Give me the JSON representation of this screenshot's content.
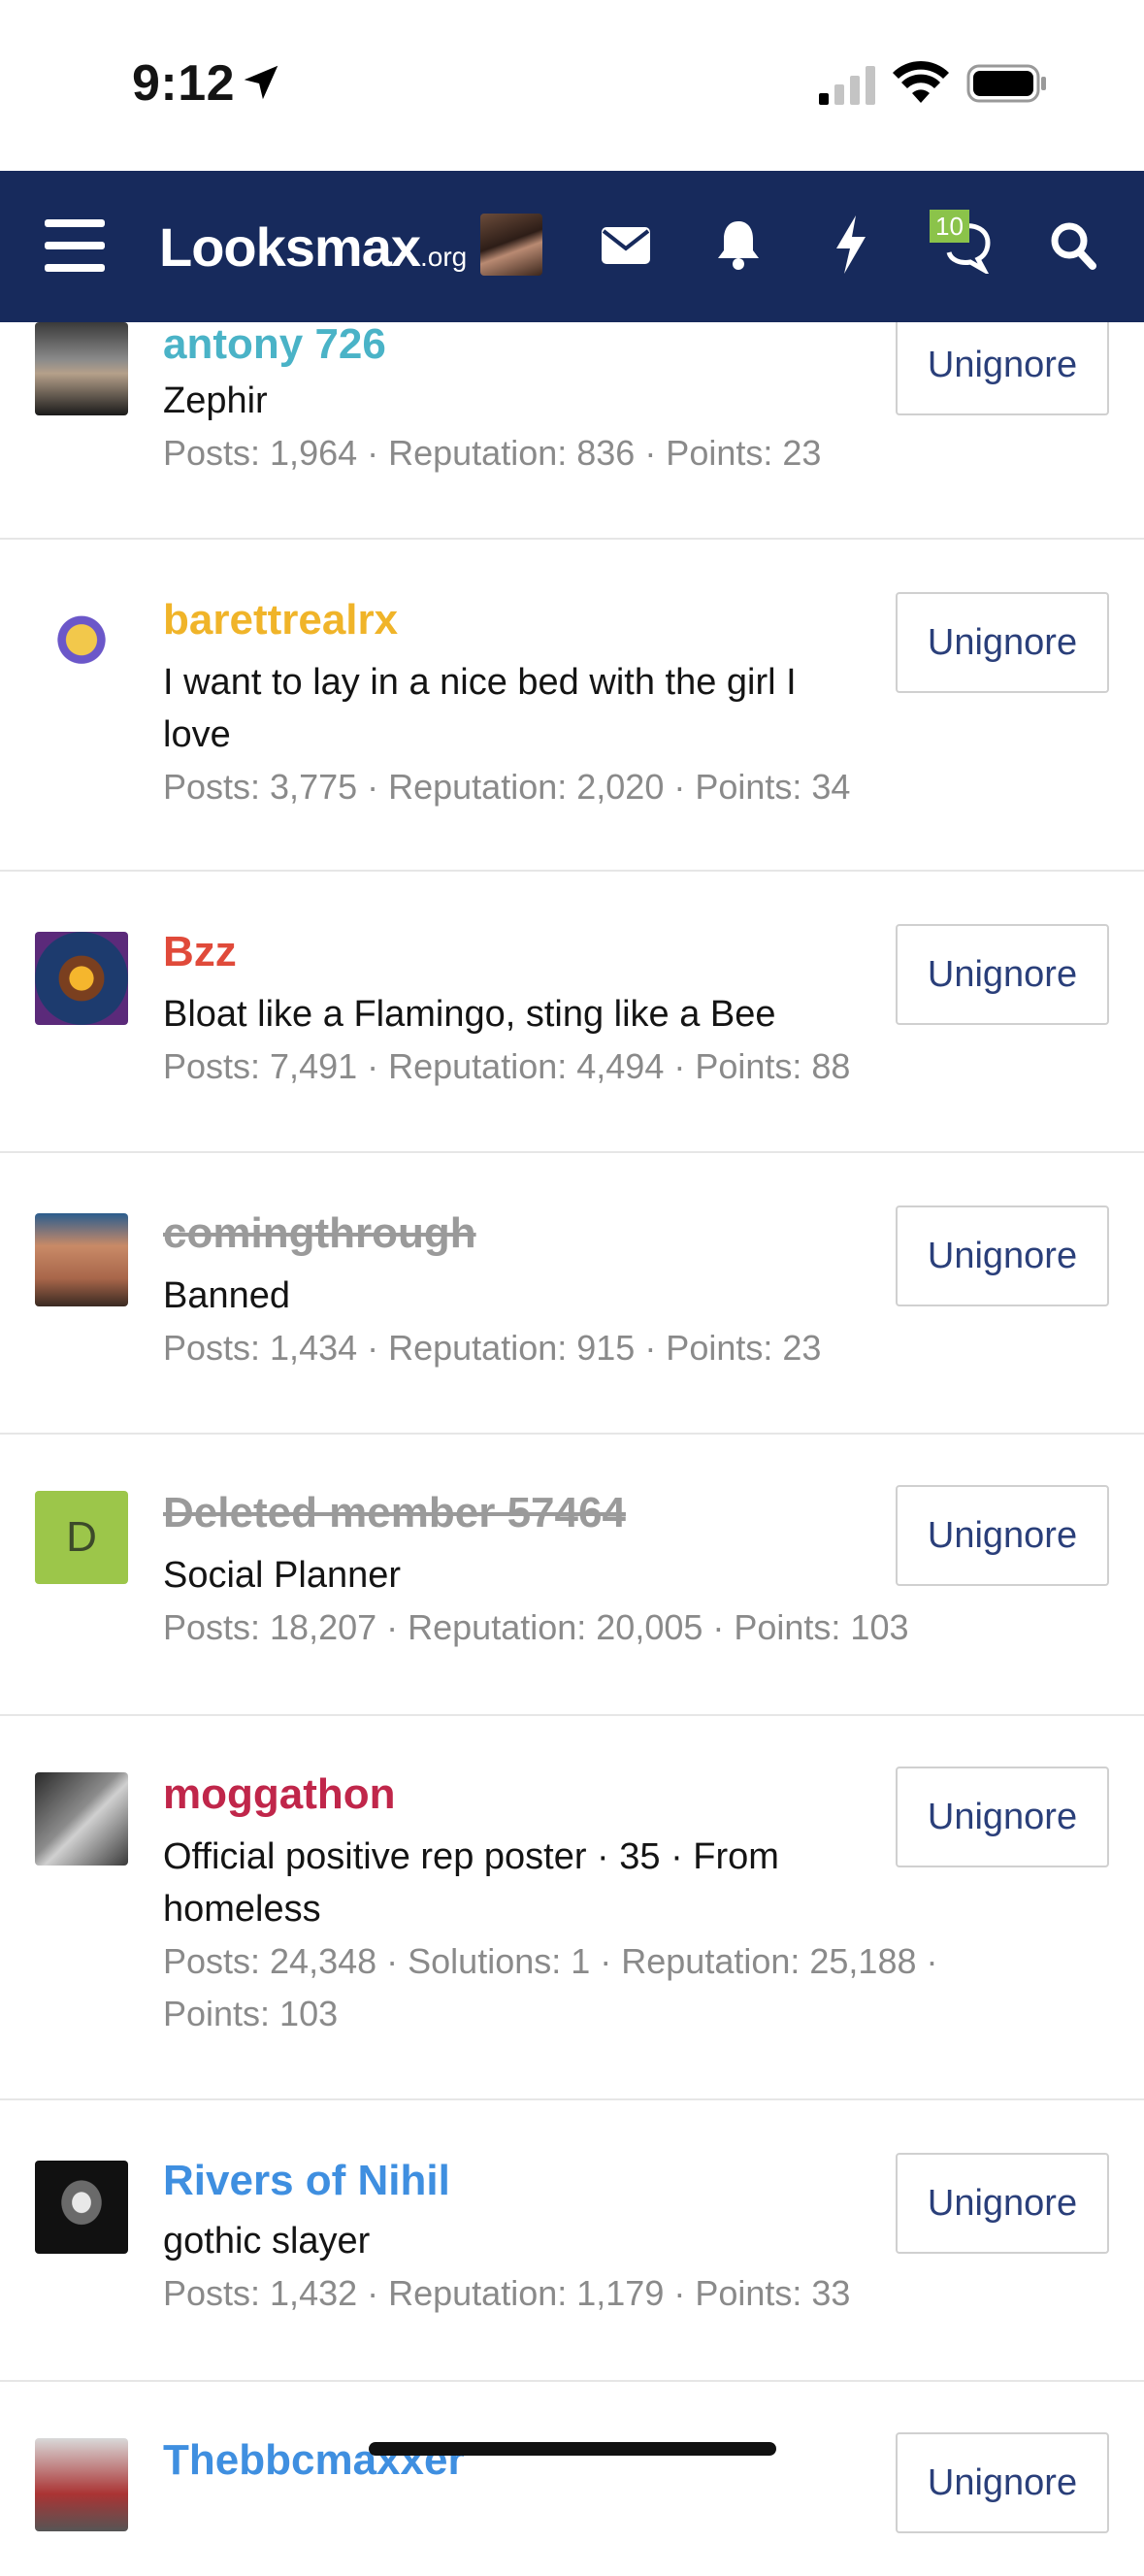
{
  "status_bar": {
    "time": "9:12"
  },
  "nav": {
    "logo_main": "Looksmax",
    "logo_tld": ".org",
    "conversations_badge": "10"
  },
  "ignored_members": [
    {
      "username": "antony 726",
      "color": "#4ab3c7",
      "banned": false,
      "title": "Zephir",
      "stats": "Posts: 1,964 · Reputation: 836 · Points: 23",
      "button": "Unignore"
    },
    {
      "username": "barettrealrx",
      "color": "#f0b429",
      "banned": false,
      "title": "I want to lay in a nice bed with the girl I love",
      "stats": "Posts: 3,775 · Reputation: 2,020 · Points: 34",
      "button": "Unignore"
    },
    {
      "username": "Bzz",
      "color": "#e04a3a",
      "banned": false,
      "title": "Bloat like a Flamingo, sting like a Bee",
      "stats": "Posts: 7,491 · Reputation: 4,494 · Points: 88",
      "button": "Unignore"
    },
    {
      "username": "comingthrough",
      "color": "#9a9a9a",
      "banned": true,
      "title": "Banned",
      "stats": "Posts: 1,434 · Reputation: 915 · Points: 23",
      "button": "Unignore"
    },
    {
      "username": "Deleted member 57464",
      "color": "#9a9a9a",
      "banned": true,
      "title": "Social Planner",
      "stats": "Posts: 18,207 · Reputation: 20,005 · Points: 103",
      "button": "Unignore",
      "avatar_letter": "D"
    },
    {
      "username": "moggathon",
      "color": "#c0264a",
      "banned": false,
      "title": "Official positive rep poster · 35 · From homeless",
      "stats": "Posts: 24,348 · Solutions: 1 · Reputation: 25,188 · Points: 103",
      "button": "Unignore"
    },
    {
      "username": "Rivers of Nihil",
      "color": "#3f8fe0",
      "banned": false,
      "title": "gothic slayer",
      "stats": "Posts: 1,432 · Reputation: 1,179 · Points: 33",
      "button": "Unignore"
    },
    {
      "username": "Thebbcmaxxer",
      "color": "#3f8fe0",
      "banned": false,
      "title": "",
      "stats": "",
      "button": "Unignore"
    }
  ]
}
